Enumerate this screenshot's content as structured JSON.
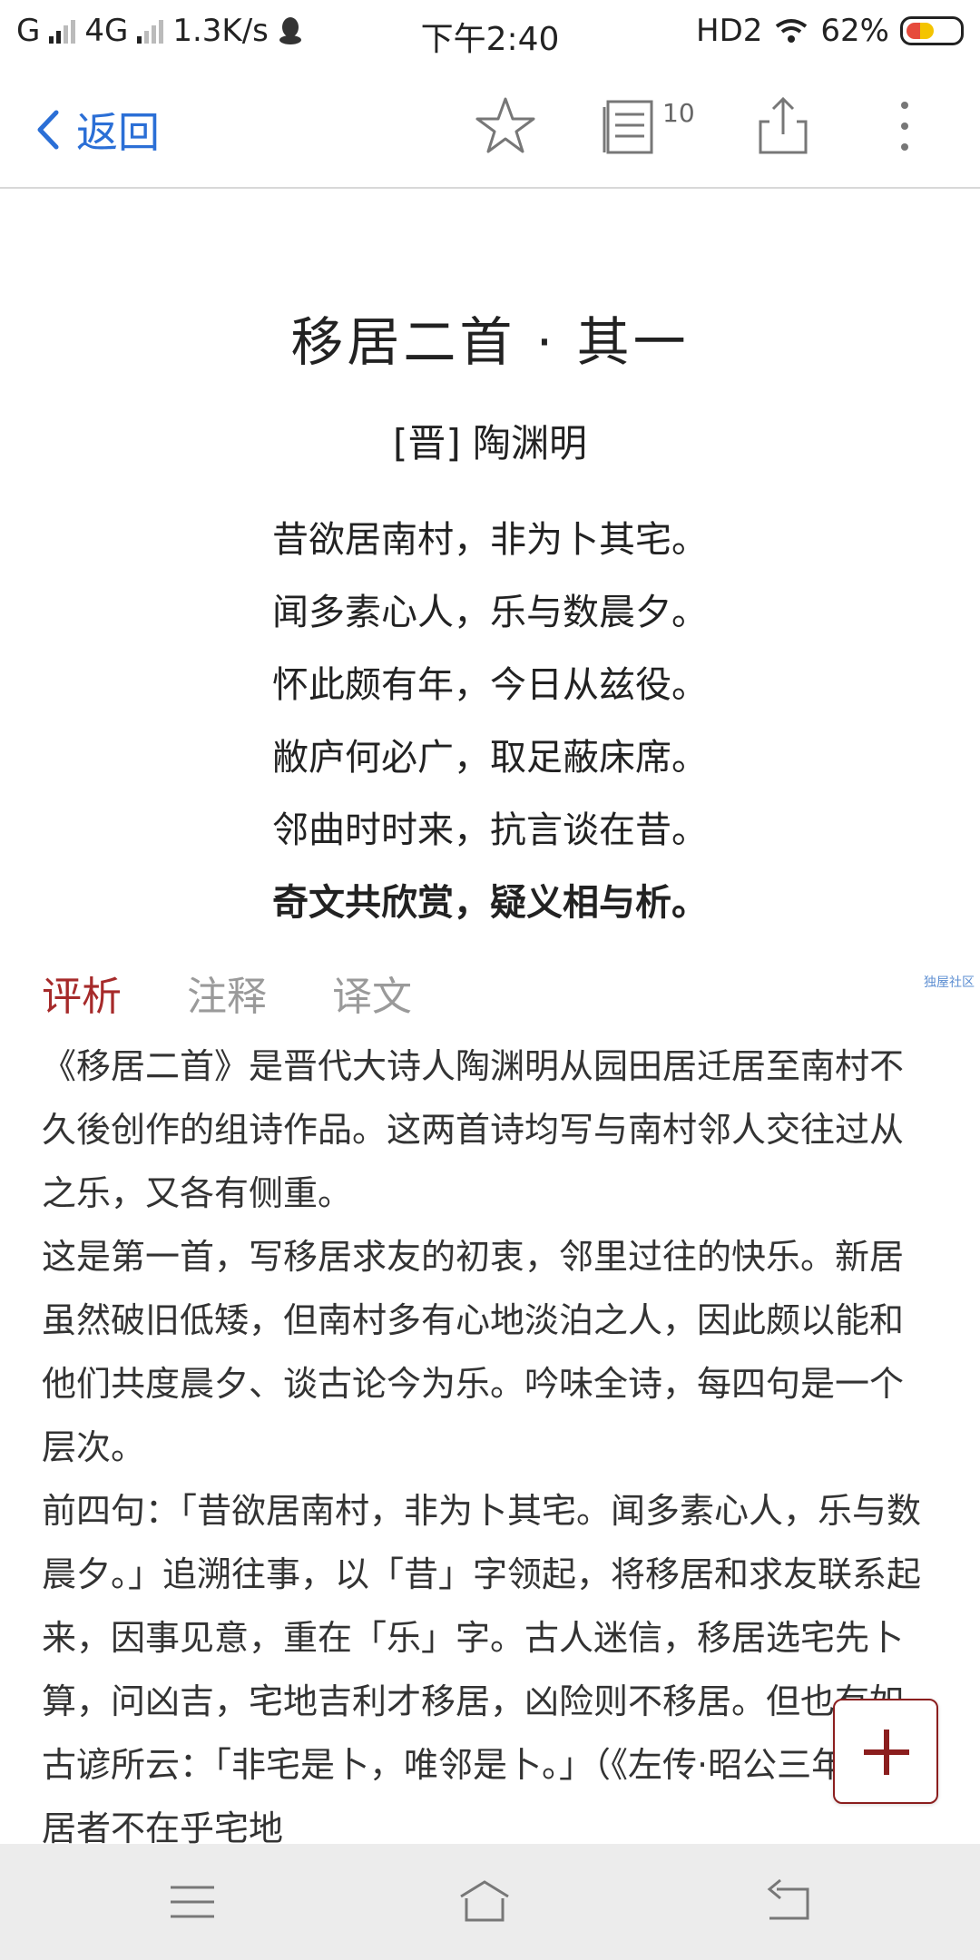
{
  "status_bar": {
    "carrier": "G",
    "network": "4G",
    "speed": "1.3K/s",
    "time": "下午2:40",
    "hd": "HD2",
    "battery": "62%"
  },
  "toolbar": {
    "back_label": "返回",
    "reading_count": "10"
  },
  "poem": {
    "title": "移居二首 · 其一",
    "author": "[晋] 陶渊明",
    "lines": [
      "昔欲居南村，非为卜其宅。",
      "闻多素心人，乐与数晨夕。",
      "怀此颇有年，今日从兹役。",
      "敝庐何必广，取足蔽床席。",
      "邻曲时时来，抗言谈在昔。",
      "奇文共欣赏，疑义相与析。"
    ]
  },
  "tabs": {
    "analysis": "评析",
    "notes": "注释",
    "translation": "译文"
  },
  "watermark": "独屋社区",
  "analysis": {
    "p1": "《移居二首》是晋代大诗人陶渊明从园田居迁居至南村不久後创作的组诗作品。这两首诗均写与南村邻人交往过从之乐，又各有侧重。",
    "p2": "这是第一首，写移居求友的初衷，邻里过往的快乐。新居虽然破旧低矮，但南村多有心地淡泊之人，因此颇以能和他们共度晨夕、谈古论今为乐。吟味全诗，每四句是一个层次。",
    "p3": "前四句：「昔欲居南村，非为卜其宅。闻多素心人，乐与数晨夕。」追溯往事，以「昔」字领起，将移居和求友联系起来，因事见意，重在「乐」字。古人迷信，移居选宅先卜算，问凶吉，宅地吉利才移居，凶险则不移居。但也有如古谚所云：「非宅是卜，唯邻是卜。」（《左传·昭公三年》）移居者不在乎宅地"
  }
}
